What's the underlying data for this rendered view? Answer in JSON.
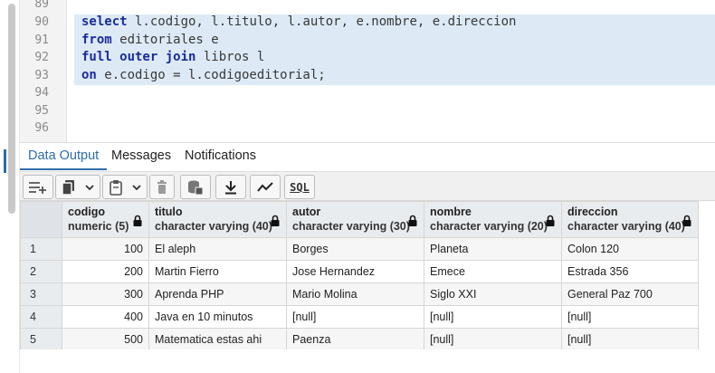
{
  "editor": {
    "lines": [
      {
        "num": "89",
        "text": ""
      },
      {
        "num": "90",
        "kw1": "select",
        "rest1": " l.codigo, l.titulo, l.autor, e.nombre, e.direccion"
      },
      {
        "num": "91",
        "kw1": "from",
        "rest1": " editoriales e"
      },
      {
        "num": "92",
        "kw1": "full outer join",
        "rest1": " libros l"
      },
      {
        "num": "93",
        "kw1": "on",
        "rest1": " e.codigo = l.codigoeditorial;"
      },
      {
        "num": "94",
        "text": ""
      },
      {
        "num": "95",
        "text": ""
      },
      {
        "num": "96",
        "text": ""
      }
    ],
    "selection_color": "#ddeaf6",
    "keyword_color": "#1a2b9a"
  },
  "tabs": [
    {
      "label": "Data Output",
      "active": true
    },
    {
      "label": "Messages",
      "active": false
    },
    {
      "label": "Notifications",
      "active": false
    }
  ],
  "toolbar": {
    "buttons": [
      "add-row-icon",
      "copy-icon",
      "chevron-down-icon",
      "paste-icon",
      "chevron-down-icon",
      "delete-icon",
      "save-data-icon",
      "download-icon",
      "graph-icon"
    ],
    "sql_label": "SQL"
  },
  "grid": {
    "columns": [
      {
        "name": "codigo",
        "type": "numeric (5)"
      },
      {
        "name": "titulo",
        "type": "character varying (40)"
      },
      {
        "name": "autor",
        "type": "character varying (30)"
      },
      {
        "name": "nombre",
        "type": "character varying (20)"
      },
      {
        "name": "direccion",
        "type": "character varying (40)"
      }
    ],
    "rows": [
      {
        "n": "1",
        "codigo": "100",
        "titulo": "El aleph",
        "autor": "Borges",
        "nombre": "Planeta",
        "direccion": "Colon 120"
      },
      {
        "n": "2",
        "codigo": "200",
        "titulo": "Martin Fierro",
        "autor": "Jose Hernandez",
        "nombre": "Emece",
        "direccion": "Estrada 356"
      },
      {
        "n": "3",
        "codigo": "300",
        "titulo": "Aprenda PHP",
        "autor": "Mario Molina",
        "nombre": "Siglo XXI",
        "direccion": "General Paz 700"
      },
      {
        "n": "4",
        "codigo": "400",
        "titulo": "Java en 10 minutos",
        "autor": "[null]",
        "nombre": "[null]",
        "direccion": "[null]"
      },
      {
        "n": "5",
        "codigo": "500",
        "titulo": "Matematica estas ahi",
        "autor": "Paenza",
        "nombre": "[null]",
        "direccion": "[null]"
      }
    ]
  },
  "colors": {
    "accent": "#2d6ca8",
    "header_bg": "#e9ecef"
  }
}
